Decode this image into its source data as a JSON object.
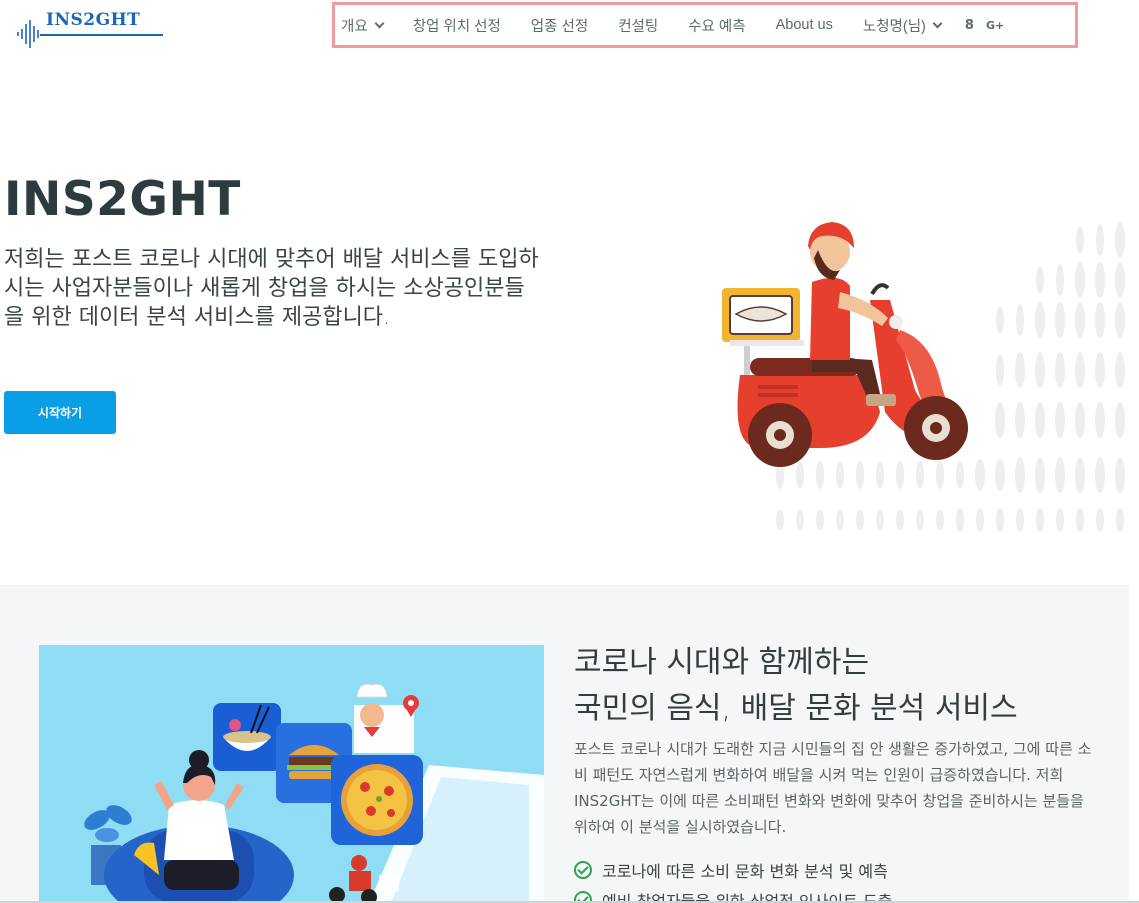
{
  "header": {
    "logo_text": "INS2GHT",
    "nav": [
      {
        "label": "개요",
        "dropdown": true
      },
      {
        "label": "창업 위치 선정"
      },
      {
        "label": "업종 선정"
      },
      {
        "label": "컨설팅"
      },
      {
        "label": "수요 예측"
      },
      {
        "label": "About us"
      },
      {
        "label": "노청명(님)",
        "dropdown": true
      }
    ],
    "social": {
      "icon1": "8",
      "icon2": "G+"
    }
  },
  "hero": {
    "title": "INS2GHT",
    "description": "저희는 포스트 코로나 시대에 맞추어 배달 서비스를 도입하시는 사업자분들이나 새롭게 창업을 하시는 소상공인분들을 위한 데이터 분석 서비스를 제공합니다.",
    "cta": "시작하기"
  },
  "section2": {
    "title_line1": "코로나 시대와 함께하는",
    "title_line2": "국민의 음식, 배달 문화 분석 서비스",
    "description": "포스트 코로나 시대가 도래한 지금 시민들의 집 안 생활은 증가하였고, 그에 따른 소비 패턴도 자연스럽게 변화하여 배달을 시켜 먹는 인원이 급증하였습니다. 저희 INS2GHT는 이에 따른 소비패턴 변화와 변화에 맞추어 창업을 준비하시는 분들을 위하여 이 분석을 실시하였습니다.",
    "checklist": [
      "코로나에 따른 소비 문화 변화 분석 및 예측",
      "예비 창업자들을 위한 상업적 인사이트 도출"
    ]
  },
  "colors": {
    "accent": "#0a9ee6",
    "logo": "#1a66b8",
    "nav_highlight": "#ee9a9f",
    "check": "#2ea44f"
  }
}
